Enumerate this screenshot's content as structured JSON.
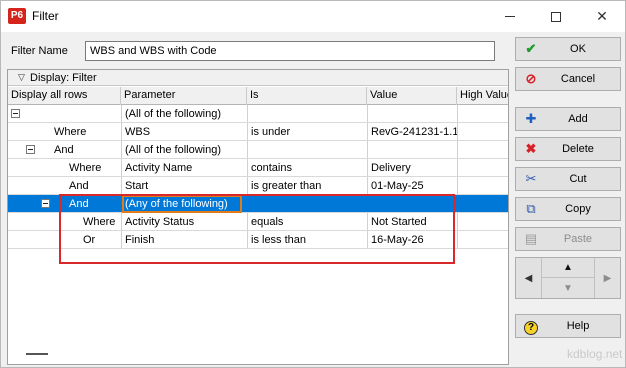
{
  "window": {
    "app_icon": "P6",
    "title": "Filter"
  },
  "filter_name": {
    "label": "Filter Name",
    "value": "WBS and WBS with Code"
  },
  "display": {
    "label": "Display: Filter"
  },
  "columns": [
    "Display all rows",
    "Parameter",
    "Is",
    "Value",
    "High Value"
  ],
  "rows": [
    {
      "op": "",
      "parameter": "(All of the following)",
      "is": "",
      "value": ""
    },
    {
      "op": "Where",
      "parameter": "WBS",
      "is": "is under",
      "value": "RevG-241231-1.1"
    },
    {
      "op": "And",
      "parameter": "(All of the following)",
      "is": "",
      "value": ""
    },
    {
      "op": "Where",
      "parameter": "Activity Name",
      "is": "contains",
      "value": "Delivery"
    },
    {
      "op": "And",
      "parameter": "Start",
      "is": "is greater than",
      "value": "01-May-25"
    },
    {
      "op": "And",
      "parameter": "(Any of the following)",
      "is": "",
      "value": ""
    },
    {
      "op": "Where",
      "parameter": "Activity Status",
      "is": "equals",
      "value": "Not Started"
    },
    {
      "op": "Or",
      "parameter": "Finish",
      "is": "is less than",
      "value": "16-May-26"
    }
  ],
  "buttons": {
    "ok": "OK",
    "cancel": "Cancel",
    "add": "Add",
    "delete": "Delete",
    "cut": "Cut",
    "copy": "Copy",
    "paste": "Paste",
    "help": "Help"
  },
  "icons": {
    "ok": "checkmark-icon",
    "cancel": "no-entry-icon",
    "add": "plus-icon",
    "delete": "red-x-icon",
    "cut": "scissors-icon",
    "copy": "copy-icon",
    "paste": "paste-icon",
    "help": "help-icon"
  },
  "colors": {
    "selection": "#0078d7",
    "highlight_orange": "#e07c1a",
    "highlight_red": "#d9282a"
  },
  "watermark": "kdblog.net"
}
